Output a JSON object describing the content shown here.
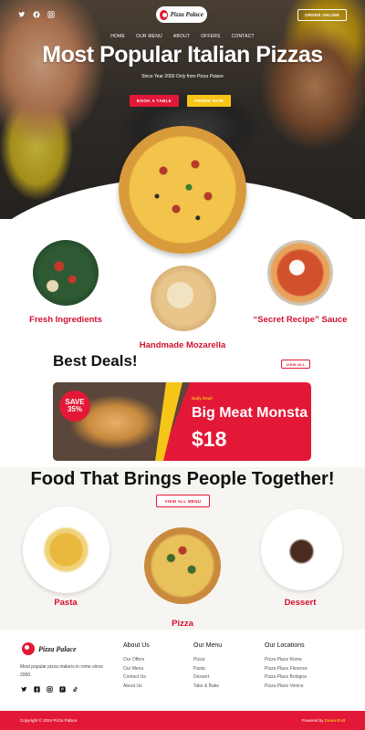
{
  "header": {
    "logo_text": "Pizza Palace",
    "order_label": "ORDER ONLINE",
    "social_icons": [
      "twitter-icon",
      "facebook-icon",
      "instagram-icon"
    ]
  },
  "nav": {
    "items": [
      "HOME",
      "OUR MENU",
      "ABOUT",
      "OFFERS",
      "CONTACT"
    ]
  },
  "hero": {
    "title": "Most Popular Italian Pizzas",
    "subtitle": "Since Year 2000 Only from Pizza Palace",
    "book_label": "BOOK A TABLE",
    "order_label": "ORDER NOW"
  },
  "features": [
    {
      "label": "Fresh Ingredients"
    },
    {
      "label": "Handmade Mozarella"
    },
    {
      "label": "“Secret Recipe” Sauce"
    }
  ],
  "deals": {
    "title": "Best Deals!",
    "view_all_label": "VIEW ALL",
    "badge_line1": "SAVE",
    "badge_line2": "35%",
    "kicker": "Daily Deal!",
    "name": "Big Meat Monsta",
    "price": "$18"
  },
  "together": {
    "title": "Food That Brings People Together!",
    "view_menu_label": "VIEW ALL MENU",
    "dishes": [
      {
        "label": "Pasta"
      },
      {
        "label": "Pizza"
      },
      {
        "label": "Dessert"
      }
    ]
  },
  "footer": {
    "logo_text": "Pizza Palace",
    "description": "Most popular pizza makers in rome since 2000.",
    "social_icons": [
      "twitter-icon",
      "facebook-icon",
      "instagram-icon",
      "pinterest-icon",
      "tiktok-icon"
    ],
    "columns": [
      {
        "title": "About Us",
        "items": [
          "Our Offers",
          "Our Menu",
          "Contact Us",
          "About Us"
        ]
      },
      {
        "title": "Our Menu",
        "items": [
          "Pizza",
          "Pasta",
          "Dessert",
          "Take & Bake"
        ]
      },
      {
        "title": "Our Locations",
        "items": [
          "Pizza Place Rome",
          "Pizza Place Florence",
          "Pizza Place Bologna",
          "Pizza Place Venice"
        ]
      }
    ],
    "copyright": "Copyright © 2024 Pizza Palace",
    "powered_by_prefix": "Powered by",
    "powered_by_name": "Zoom-It UI"
  },
  "colors": {
    "brand_red": "#e31837",
    "accent_yellow": "#f5c518",
    "section_bg": "#f7f5f1"
  }
}
